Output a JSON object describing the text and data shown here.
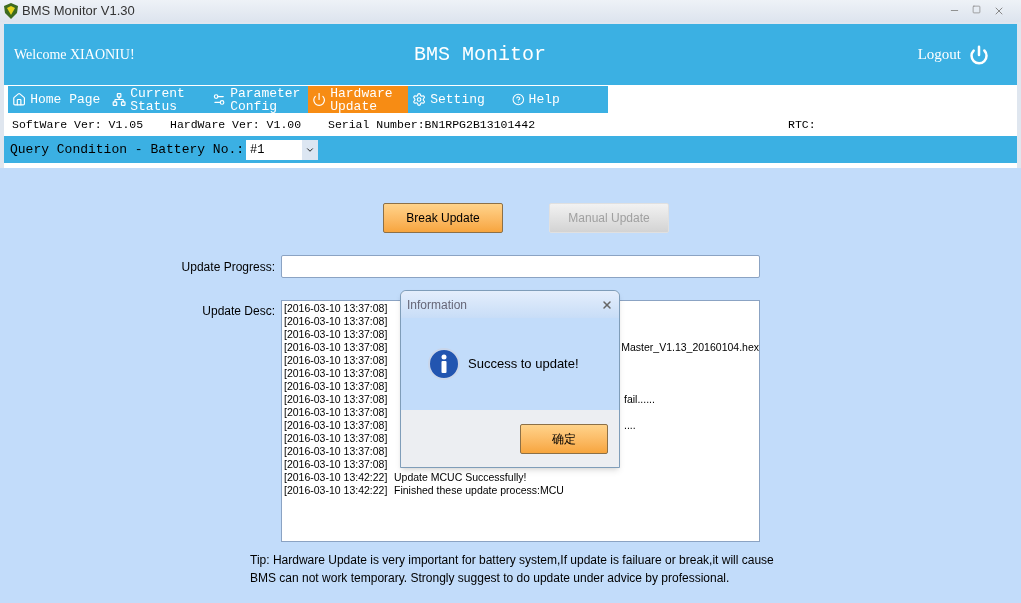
{
  "window": {
    "title": "BMS Monitor V1.30"
  },
  "header": {
    "welcome": "Welcome XIAONIU!",
    "title": "BMS Monitor",
    "logout": "Logout"
  },
  "nav": [
    {
      "label": "Home Page",
      "selected": false
    },
    {
      "label": "Current Status",
      "selected": false
    },
    {
      "label": "Parameter Config",
      "selected": false
    },
    {
      "label": "Hardware Update",
      "selected": true
    },
    {
      "label": "Setting",
      "selected": false
    },
    {
      "label": "Help",
      "selected": false
    }
  ],
  "info": {
    "software": "SoftWare Ver: V1.05",
    "hardware": "HardWare Ver: V1.00",
    "serial": "Serial Number:BN1RPG2B13101442",
    "rtc": "RTC:"
  },
  "query": {
    "label": "Query Condition - Battery No.:",
    "value": "#1"
  },
  "buttons": [
    {
      "label": "Break Update",
      "disabled": false
    },
    {
      "label": "Manual Update",
      "disabled": true
    }
  ],
  "progress": {
    "label": "Update Progress:",
    "level": 0
  },
  "log": {
    "label": "Update Desc:",
    "lines": [
      {
        "time": "[2016-03-10 13:37:08]",
        "kind": "tail"
      },
      {
        "time": "[2016-03-10 13:37:08]",
        "kind": "tail"
      },
      {
        "time": "[2016-03-10 13:37:08]",
        "kind": "tail"
      },
      {
        "time": "[2016-03-10 13:37:08]",
        "kind": "tail",
        "text": "Master_V1.13_20160104.hex"
      },
      {
        "time": "[2016-03-10 13:37:08]",
        "kind": "tail"
      },
      {
        "time": "[2016-03-10 13:37:08]",
        "kind": "tail"
      },
      {
        "time": "[2016-03-10 13:37:08]",
        "kind": "tail"
      },
      {
        "time": "[2016-03-10 13:37:08]",
        "kind": "tail",
        "text": "fail......"
      },
      {
        "time": "[2016-03-10 13:37:08]",
        "kind": "tail"
      },
      {
        "time": "[2016-03-10 13:37:08]",
        "kind": "tail",
        "text": "...."
      },
      {
        "time": "[2016-03-10 13:37:08]",
        "kind": "tail"
      },
      {
        "time": "[2016-03-10 13:37:08]",
        "kind": "tail"
      },
      {
        "time": "[2016-03-10 13:37:08]",
        "kind": "tail"
      },
      {
        "time": "[2016-03-10 13:42:22]",
        "kind": "full",
        "text": "Update MCUC Successfully!"
      },
      {
        "time": "[2016-03-10 13:42:22]",
        "kind": "full",
        "text": "Finished these update process:MCU"
      }
    ]
  },
  "tip": "Tip: Hardware Update is very important for battery system,If update is failuare or break,it will cause BMS can not work temporary. Strongly suggest to do update under advice by professional.",
  "dialog": {
    "title": "Information",
    "message": "Success to update!",
    "button": "确定"
  }
}
